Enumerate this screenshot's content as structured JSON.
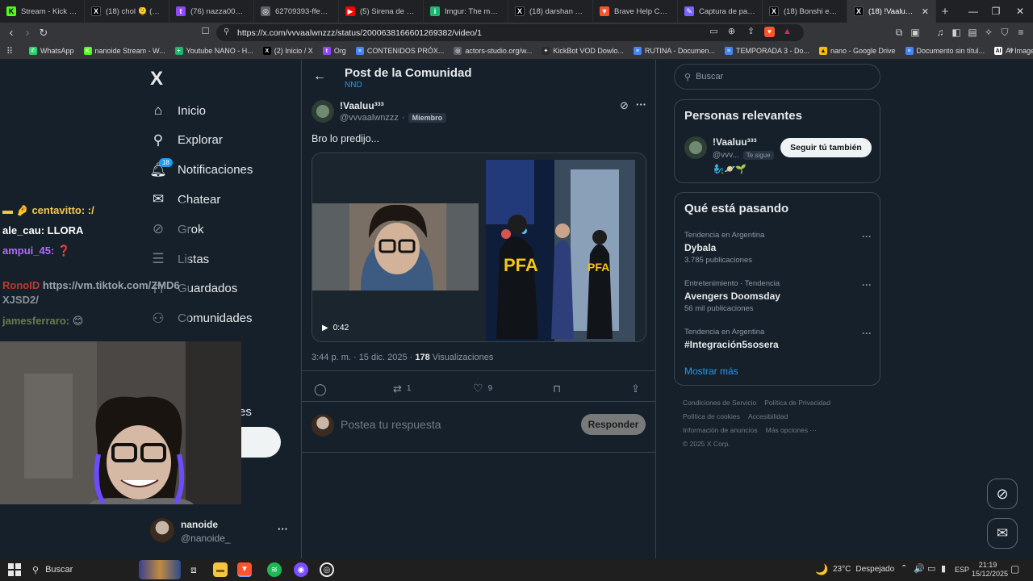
{
  "browser": {
    "tabs": [
      {
        "title": "Stream - Kick Da",
        "fav_color": "#53fc18",
        "fav_char": "K",
        "fav_text_color": "#000"
      },
      {
        "title": "(18) chol 🫠 (@sol_sc",
        "fav_color": "#000000",
        "fav_char": "X",
        "fav_text_color": "#fff"
      },
      {
        "title": "(76) nazza005 - Twitc",
        "fav_color": "#9146ff",
        "fav_char": "t",
        "fav_text_color": "#fff"
      },
      {
        "title": "62709393-ffeb-414",
        "fav_color": "#5f6368",
        "fav_char": "◎",
        "fav_text_color": "#fff"
      },
      {
        "title": "(5) Sirena de Policía",
        "fav_color": "#ff0000",
        "fav_char": "▶",
        "fav_text_color": "#fff"
      },
      {
        "title": "Imgur: The magic o",
        "fav_color": "#1bb76e",
        "fav_char": "i",
        "fav_text_color": "#fff"
      },
      {
        "title": "(18) darshan en X:",
        "fav_color": "#000000",
        "fav_char": "X",
        "fav_text_color": "#fff"
      },
      {
        "title": "Brave Help Center",
        "fav_color": "#fb542b",
        "fav_char": "▼",
        "fav_text_color": "#fff"
      },
      {
        "title": "Captura de pantalla",
        "fav_color": "#7b61ff",
        "fav_char": "✎",
        "fav_text_color": "#fff"
      },
      {
        "title": "(18) Bonshi en X: \"",
        "fav_color": "#000000",
        "fav_char": "X",
        "fav_text_color": "#fff"
      },
      {
        "title": "(18) !Vaaluu³³³ e",
        "fav_color": "#000000",
        "fav_char": "X",
        "fav_text_color": "#fff",
        "active": true
      }
    ],
    "url": "https://x.com/vvvaalwnzzz/status/2000638166601269382/video/1",
    "bookmarks": [
      {
        "label": "WhatsApp",
        "color": "#25d366",
        "char": "✆"
      },
      {
        "label": "nanoide Stream - W...",
        "color": "#53fc18",
        "char": "K"
      },
      {
        "label": "Youtube NANO - H...",
        "color": "#1bb76e",
        "char": "+"
      },
      {
        "label": "(2) Inicio / X",
        "color": "#000000",
        "char": "X"
      },
      {
        "label": "Org",
        "color": "#9146ff",
        "char": "t"
      },
      {
        "label": "CONTENIDOS PRÓX...",
        "color": "#4285f4",
        "char": "≡"
      },
      {
        "label": "actors-studio.org/w...",
        "color": "#5f6368",
        "char": "◎"
      },
      {
        "label": "KickBot VOD Dowlo...",
        "color": "#2b2b2b",
        "char": "✦"
      },
      {
        "label": "RUTINA - Documen...",
        "color": "#4285f4",
        "char": "≡"
      },
      {
        "label": "TEMPORADA 3 - Do...",
        "color": "#4285f4",
        "char": "≡"
      },
      {
        "label": "nano - Google Drive",
        "color": "#fbbc04",
        "char": "▲"
      },
      {
        "label": "Documento sin títul...",
        "color": "#4285f4",
        "char": "≡"
      },
      {
        "label": "AI Image Upscaler |...",
        "color": "#ffffff",
        "char": "AI"
      }
    ]
  },
  "nav": {
    "logo": "X",
    "items": [
      {
        "label": "Inicio",
        "icon": "home-icon"
      },
      {
        "label": "Explorar",
        "icon": "search-icon"
      },
      {
        "label": "Notificaciones",
        "icon": "bell-icon",
        "badge": "18"
      },
      {
        "label": "Chatear",
        "icon": "mail-icon"
      },
      {
        "label": "Grok",
        "icon": "grok-icon"
      },
      {
        "label": "Listas",
        "icon": "list-icon"
      },
      {
        "label": "Guardados",
        "icon": "bookmark-icon"
      },
      {
        "label": "Comunidades",
        "icon": "communities-icon"
      }
    ],
    "partial_more": "es",
    "account": {
      "name": "nanoide",
      "handle": "@nanoide_",
      "more": "···"
    }
  },
  "chat": {
    "lines": [
      {
        "user": "",
        "text": "centavitto: :/",
        "color": "#f2c94c",
        "prefix": "▬ 🤌"
      },
      {
        "user": "ale_cau:",
        "text": "LLORA",
        "color": "#ffffff"
      },
      {
        "user": "ampui_45:",
        "text": "❓",
        "color": "#b36bff"
      },
      {
        "user": "RonoID",
        "text": "https://vm.tiktok.com/ZMD6",
        "color": "#c0392b"
      },
      {
        "user": "",
        "text": "XJSD2/",
        "color": "#8a9299"
      },
      {
        "user": "jamesferraro:",
        "text": "😊",
        "color": "#6b7b4a"
      }
    ]
  },
  "post": {
    "header_title": "Post de la Comunidad",
    "header_sub": "NND",
    "author_name": "!Vaaluu³³³",
    "author_handle": "@vvvaalwnzzz",
    "member_badge": "Miembro",
    "dot": "·",
    "text": "Bro lo predijo...",
    "video_duration": "0:42",
    "timestamp": "3:44 p. m. · 15 dic. 2025 ·",
    "views_count": "178",
    "views_label": "Visualizaciones",
    "retweets": "1",
    "likes": "9",
    "reply_placeholder": "Postea tu respuesta",
    "reply_button": "Responder",
    "pfa_text": "PFA"
  },
  "sidebar": {
    "search_placeholder": "Buscar",
    "relevant_title": "Personas relevantes",
    "relevant_user": {
      "name": "!Vaaluu³³³",
      "handle": "@vvv...",
      "follows_you": "Te sigue",
      "follow_button": "Seguir tú también",
      "emojis": "🧞‍♂️🪐🌱"
    },
    "trends_title": "Qué está pasando",
    "trends": [
      {
        "context": "Tendencia en Argentina",
        "name": "Dybala",
        "count": "3.785 publicaciones"
      },
      {
        "context": "Entretenimiento · Tendencia",
        "name": "Avengers Doomsday",
        "count": "56 mil publicaciones"
      },
      {
        "context": "Tendencia en Argentina",
        "name": "#Integración5sosera",
        "count": ""
      }
    ],
    "show_more": "Mostrar más",
    "footer": [
      [
        "Condiciones de Servicio",
        "Política de Privacidad"
      ],
      [
        "Política de cookies",
        "Accesibilidad"
      ],
      [
        "Información de anuncios",
        "Más opciones ···"
      ],
      [
        "© 2025 X Corp."
      ]
    ]
  },
  "taskbar": {
    "search_label": "Buscar",
    "weather_temp": "23°C",
    "weather_desc": "Despejado",
    "lang": "ESP",
    "time": "21:19",
    "date": "15/12/2025"
  },
  "colors": {
    "bg": "#15202b",
    "border": "#38444d",
    "muted": "#8b98a5",
    "link": "#1d9bf0"
  }
}
